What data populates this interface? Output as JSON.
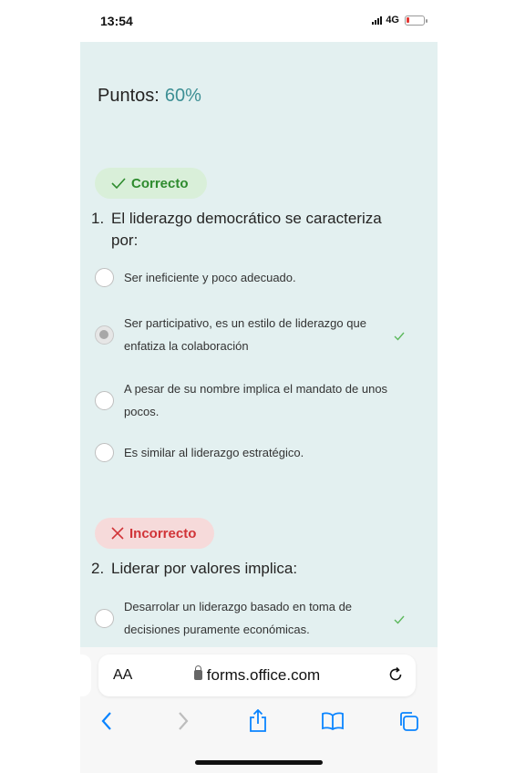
{
  "status_bar": {
    "time": "13:54",
    "network": "4G",
    "battery_level": 0.15
  },
  "score": {
    "label": "Puntos:",
    "value": "60%"
  },
  "questions": [
    {
      "result": "Correcto",
      "number": "1.",
      "text": "El liderazgo democrático se caracteriza por:",
      "options": [
        {
          "text": "Ser ineficiente y poco adecuado.",
          "selected": false,
          "correct": false
        },
        {
          "text": "Ser participativo, es un estilo de liderazgo que enfatiza la colaboración",
          "selected": true,
          "correct": true
        },
        {
          "text": "A pesar de su nombre implica el mandato de unos pocos.",
          "selected": false,
          "correct": false
        },
        {
          "text": "Es similar al liderazgo estratégico.",
          "selected": false,
          "correct": false
        }
      ]
    },
    {
      "result": "Incorrecto",
      "number": "2.",
      "text": "Liderar por valores implica:",
      "options": [
        {
          "text": "Desarrolar un liderazgo basado en toma de decisiones puramente económicas.",
          "selected": false,
          "correct": true
        }
      ]
    }
  ],
  "browser": {
    "text_size_label": "AA",
    "url": "forms.office.com"
  },
  "colors": {
    "background": "#e3f0f0",
    "correct_green": "#2e8b2e",
    "incorrect_red": "#d13438",
    "score_teal": "#3d8f94",
    "ios_blue": "#0a84ff"
  },
  "icons": [
    "check-icon",
    "x-icon",
    "lock-icon",
    "reload-icon",
    "back-icon",
    "forward-icon",
    "share-icon",
    "bookmarks-icon",
    "tabs-icon"
  ]
}
